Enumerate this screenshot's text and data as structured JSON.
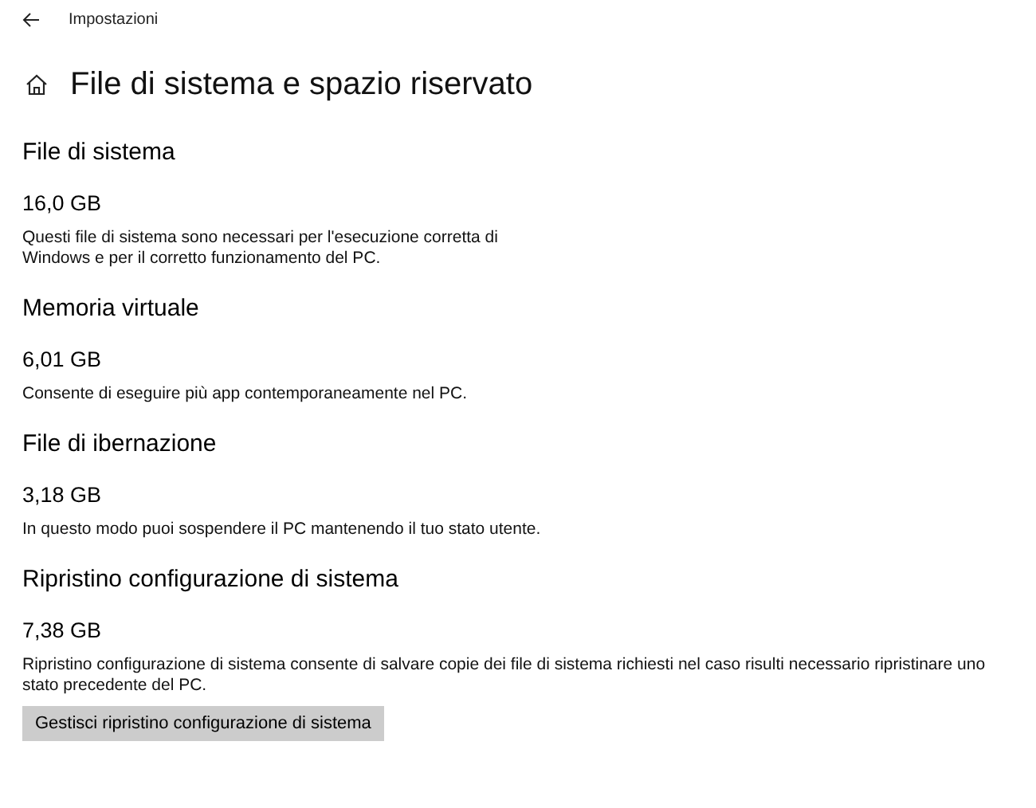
{
  "window": {
    "title": "Impostazioni"
  },
  "page_title": "File di sistema e spazio riservato",
  "sections": [
    {
      "heading": "File di sistema",
      "size": "16,0 GB",
      "description": [
        "Questi file di sistema sono necessari per l'esecuzione corretta di",
        "Windows e per il corretto funzionamento del PC."
      ]
    },
    {
      "heading": "Memoria virtuale",
      "size": "6,01 GB",
      "description": [
        "Consente di eseguire più app contemporaneamente nel PC."
      ]
    },
    {
      "heading": "File di ibernazione",
      "size": "3,18 GB",
      "description": [
        "In questo modo puoi sospendere il PC mantenendo il tuo stato utente."
      ]
    },
    {
      "heading": "Ripristino configurazione di sistema",
      "size": "7,38 GB",
      "description": [
        "Ripristino configurazione di sistema consente di salvare copie dei file di sistema richiesti nel caso risulti necessario ripristinare uno",
        "stato precedente del PC."
      ],
      "button": "Gestisci ripristino configurazione di sistema"
    }
  ]
}
